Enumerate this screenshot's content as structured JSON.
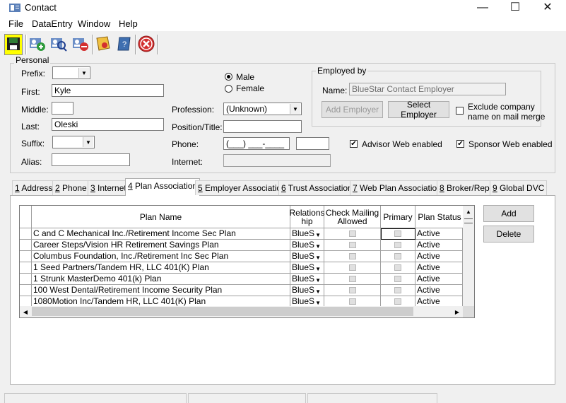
{
  "window": {
    "title": "Contact",
    "minimize": "—",
    "maximize": "☐",
    "close": "✕"
  },
  "menu": [
    "File",
    "DataEntry",
    "Window",
    "Help"
  ],
  "toolbar": [
    "save-icon",
    "add-contact-icon",
    "find-contact-icon",
    "remove-contact-icon",
    "notes-icon",
    "help-book-icon",
    "close-icon"
  ],
  "personal": {
    "group_label": "Personal",
    "prefix_label": "Prefix:",
    "prefix_value": "",
    "first_label": "First:",
    "first_value": "Kyle",
    "middle_label": "Middle:",
    "middle_value": "",
    "last_label": "Last:",
    "last_value": "Oleski",
    "suffix_label": "Suffix:",
    "suffix_value": "",
    "alias_label": "Alias:",
    "alias_value": "",
    "gender_male": "Male",
    "gender_female": "Female",
    "gender_selected": "Male",
    "profession_label": "Profession:",
    "profession_value": "(Unknown)",
    "position_label": "Position/Title:",
    "position_value": "",
    "phone_label": "Phone:",
    "phone_value": "(___) ___-____",
    "phone_ext": "",
    "internet_label": "Internet:",
    "internet_value": ""
  },
  "employed_by": {
    "group_label": "Employed by",
    "name_label": "Name:",
    "name_value": "BlueStar Contact Employer",
    "add_employer": "Add Employer",
    "select_employer": "Select Employer",
    "exclude_label_1": "Exclude company",
    "exclude_label_2": "name on mail merge",
    "exclude_checked": false
  },
  "advisor_web": {
    "label": "Advisor Web enabled",
    "checked": true
  },
  "sponsor_web": {
    "label": "Sponsor Web enabled",
    "checked": true
  },
  "tabs": [
    {
      "key": "1",
      "rest": " Address"
    },
    {
      "key": "2",
      "rest": " Phone"
    },
    {
      "key": "3",
      "rest": " Internet"
    },
    {
      "key": "4",
      "rest": " Plan Association"
    },
    {
      "key": "5",
      "rest": " Employer Association"
    },
    {
      "key": "6",
      "rest": " Trust Association"
    },
    {
      "key": "7",
      "rest": " Web Plan Association"
    },
    {
      "key": "8",
      "rest": " Broker/Rep"
    },
    {
      "key": "9",
      "rest": " Global DVC"
    }
  ],
  "active_tab": "4",
  "grid": {
    "headers": {
      "plan_name": "Plan Name",
      "relationship_1": "Relations",
      "relationship_2": "hip",
      "check_mailing_1": "Check Mailing",
      "check_mailing_2": "Allowed",
      "primary": "Primary",
      "plan_status": "Plan Status"
    },
    "rows": [
      {
        "plan": "C and C Mechanical Inc./Retirement Income Sec Plan",
        "rel": "BlueS",
        "status": "Active"
      },
      {
        "plan": "Career Steps/Vision HR Retirement Savings Plan",
        "rel": "BlueS",
        "status": "Active"
      },
      {
        "plan": "Columbus Foundation, Inc./Retirement Inc Sec Plan",
        "rel": "BlueS",
        "status": "Active"
      },
      {
        "plan": "1 Seed Partners/Tandem HR, LLC 401(K) Plan",
        "rel": "BlueS",
        "status": "Active"
      },
      {
        "plan": "1 Strunk MasterDemo 401(k) Plan",
        "rel": "BlueS",
        "status": "Active"
      },
      {
        "plan": "100 West Dental/Retirement Income Security Plan",
        "rel": "BlueS",
        "status": "Active"
      },
      {
        "plan": "1080Motion Inc/Tandem HR, LLC 401(K) Plan",
        "rel": "BlueS",
        "status": "Active"
      }
    ]
  },
  "buttons": {
    "add": "Add",
    "delete": "Delete"
  }
}
